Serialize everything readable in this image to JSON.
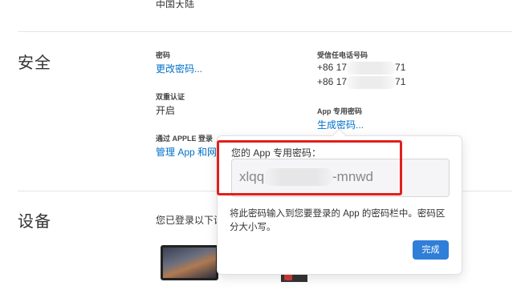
{
  "top_cut_text": "中国大陆",
  "security": {
    "title": "安全",
    "password": {
      "label": "密码",
      "link": "更改密码..."
    },
    "two_factor": {
      "label": "双重认证",
      "value": "开启"
    },
    "apple_login": {
      "label": "通过 APPLE 登录",
      "link": "管理 App 和网"
    },
    "trusted_phone": {
      "label": "受信任电话号码",
      "numbers": [
        {
          "prefix": "+86 17",
          "suffix": "71"
        },
        {
          "prefix": "+86 17",
          "suffix": "71"
        }
      ]
    },
    "app_password": {
      "label": "App 专用密码",
      "link": "生成密码..."
    }
  },
  "devices": {
    "title": "设备",
    "desc": "您已登录以下设"
  },
  "popover": {
    "title": "您的 App 专用密码：",
    "password_prefix": "xlqq",
    "password_suffix": "-mnwd",
    "hint": "将此密码输入到您要登录的 App 的密码栏中。密码区分大小写。",
    "done": "完成"
  },
  "colors": {
    "link": "#0070c9",
    "button": "#2f7ed8",
    "highlight": "#e0201b"
  }
}
